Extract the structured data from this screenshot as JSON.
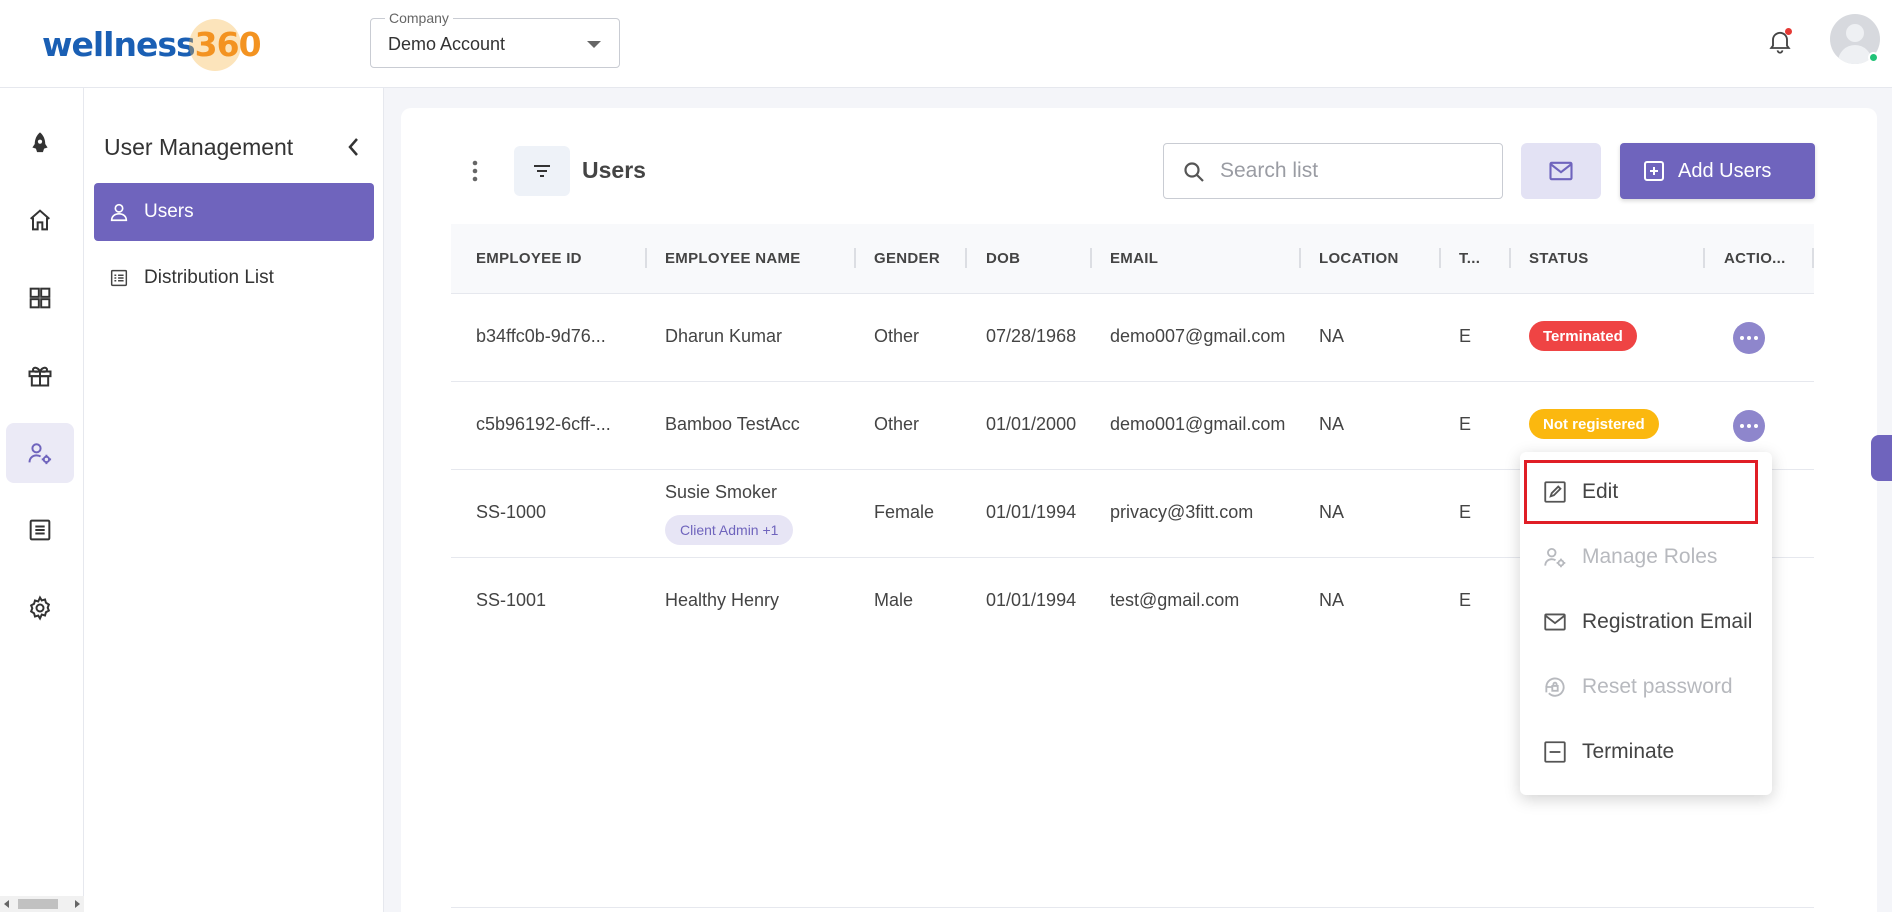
{
  "brand": {
    "part1": "wellness",
    "part2": "360"
  },
  "company": {
    "label": "Company",
    "value": "Demo Account"
  },
  "nav": {
    "rail": [
      "rocket-icon",
      "home-icon",
      "dashboard-icon",
      "gift-icon",
      "user-settings-icon",
      "list-icon",
      "gear-icon"
    ]
  },
  "subnav": {
    "title": "User Management",
    "items": [
      {
        "label": "Users",
        "icon": "person-icon",
        "active": true
      },
      {
        "label": "Distribution List",
        "icon": "list-icon",
        "active": false
      }
    ]
  },
  "toolbar": {
    "title": "Users",
    "search_placeholder": "Search list",
    "add_label": "Add Users"
  },
  "table": {
    "columns": [
      "EMPLOYEE ID",
      "EMPLOYEE NAME",
      "GENDER",
      "DOB",
      "EMAIL",
      "LOCATION",
      "T...",
      "STATUS",
      "ACTIO..."
    ],
    "rows": [
      {
        "id": "b34ffc0b-9d76...",
        "name": "Dharun Kumar",
        "chip": "",
        "gender": "Other",
        "dob": "07/28/1968",
        "email": "demo007@gmail.com",
        "location": "NA",
        "t": "E",
        "status": "Terminated"
      },
      {
        "id": "c5b96192-6cff-...",
        "name": "Bamboo TestAcc",
        "chip": "",
        "gender": "Other",
        "dob": "01/01/2000",
        "email": "demo001@gmail.com",
        "location": "NA",
        "t": "E",
        "status": "Not registered"
      },
      {
        "id": "SS-1000",
        "name": "Susie Smoker",
        "chip": "Client Admin +1",
        "gender": "Female",
        "dob": "01/01/1994",
        "email": "privacy@3fitt.com",
        "location": "NA",
        "t": "E",
        "status": ""
      },
      {
        "id": "SS-1001",
        "name": "Healthy Henry",
        "chip": "",
        "gender": "Male",
        "dob": "01/01/1994",
        "email": "test@gmail.com",
        "location": "NA",
        "t": "E",
        "status": ""
      }
    ]
  },
  "status_colors": {
    "Terminated": "#ef4444",
    "Not registered": "#fbb80f"
  },
  "accent": "#6f64bd",
  "action_menu": {
    "items": [
      {
        "label": "Edit",
        "icon": "edit-icon",
        "disabled": false
      },
      {
        "label": "Manage Roles",
        "icon": "manage-roles-icon",
        "disabled": true
      },
      {
        "label": "Registration Email",
        "icon": "mail-icon",
        "disabled": false
      },
      {
        "label": "Reset password",
        "icon": "lock-reset-icon",
        "disabled": true
      },
      {
        "label": "Terminate",
        "icon": "terminate-icon",
        "disabled": false
      }
    ]
  }
}
